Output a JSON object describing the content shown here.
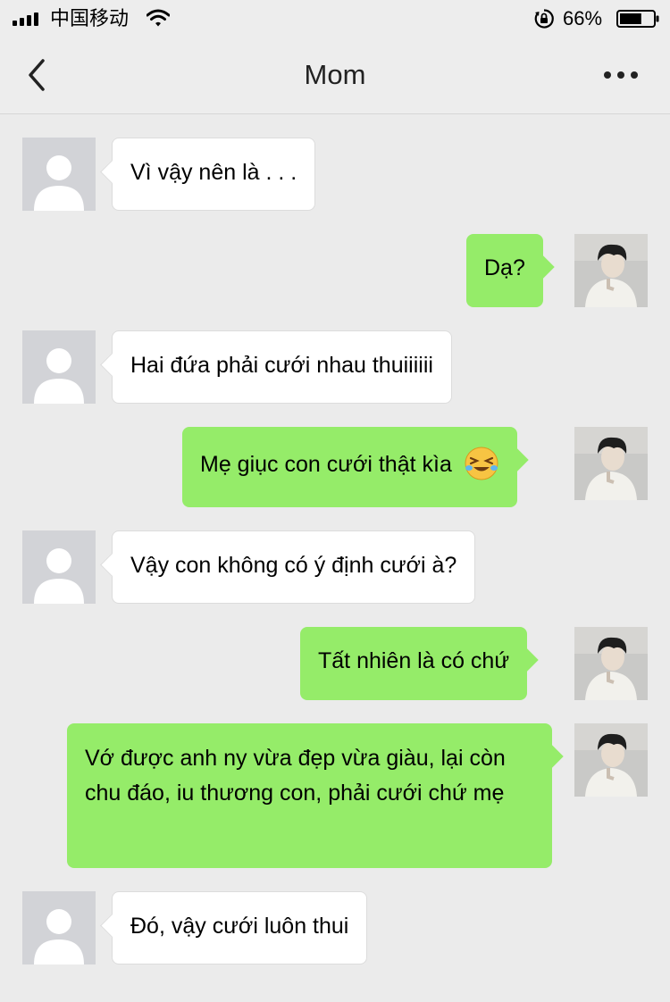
{
  "status_bar": {
    "carrier": "中国移动",
    "battery_percent": "66%",
    "battery_level": 0.66
  },
  "header": {
    "title": "Mom",
    "back_icon": "chevron-left-icon",
    "more_icon": "more-dots-icon"
  },
  "colors": {
    "background": "#ebebeb",
    "incoming_bubble": "#ffffff",
    "outgoing_bubble": "#95ec69"
  },
  "messages": [
    {
      "sender": "mom",
      "text": "Vì vậy nên là . . ."
    },
    {
      "sender": "me",
      "text": "Dạ?"
    },
    {
      "sender": "mom",
      "text": "Hai đứa phải cưới nhau thuiiiiii"
    },
    {
      "sender": "me",
      "text": "Mẹ giục con cưới thật kìa",
      "emoji": "crying-laughing-face-icon"
    },
    {
      "sender": "mom",
      "text": "Vậy con không có ý định cưới à?"
    },
    {
      "sender": "me",
      "text": "Tất nhiên là có chứ"
    },
    {
      "sender": "me",
      "text": "Vớ được anh ny vừa đẹp vừa giàu, lại còn chu đáo, iu thương con, phải cưới chứ mẹ"
    },
    {
      "sender": "mom",
      "text": "Đó, vậy cưới luôn thui"
    }
  ]
}
